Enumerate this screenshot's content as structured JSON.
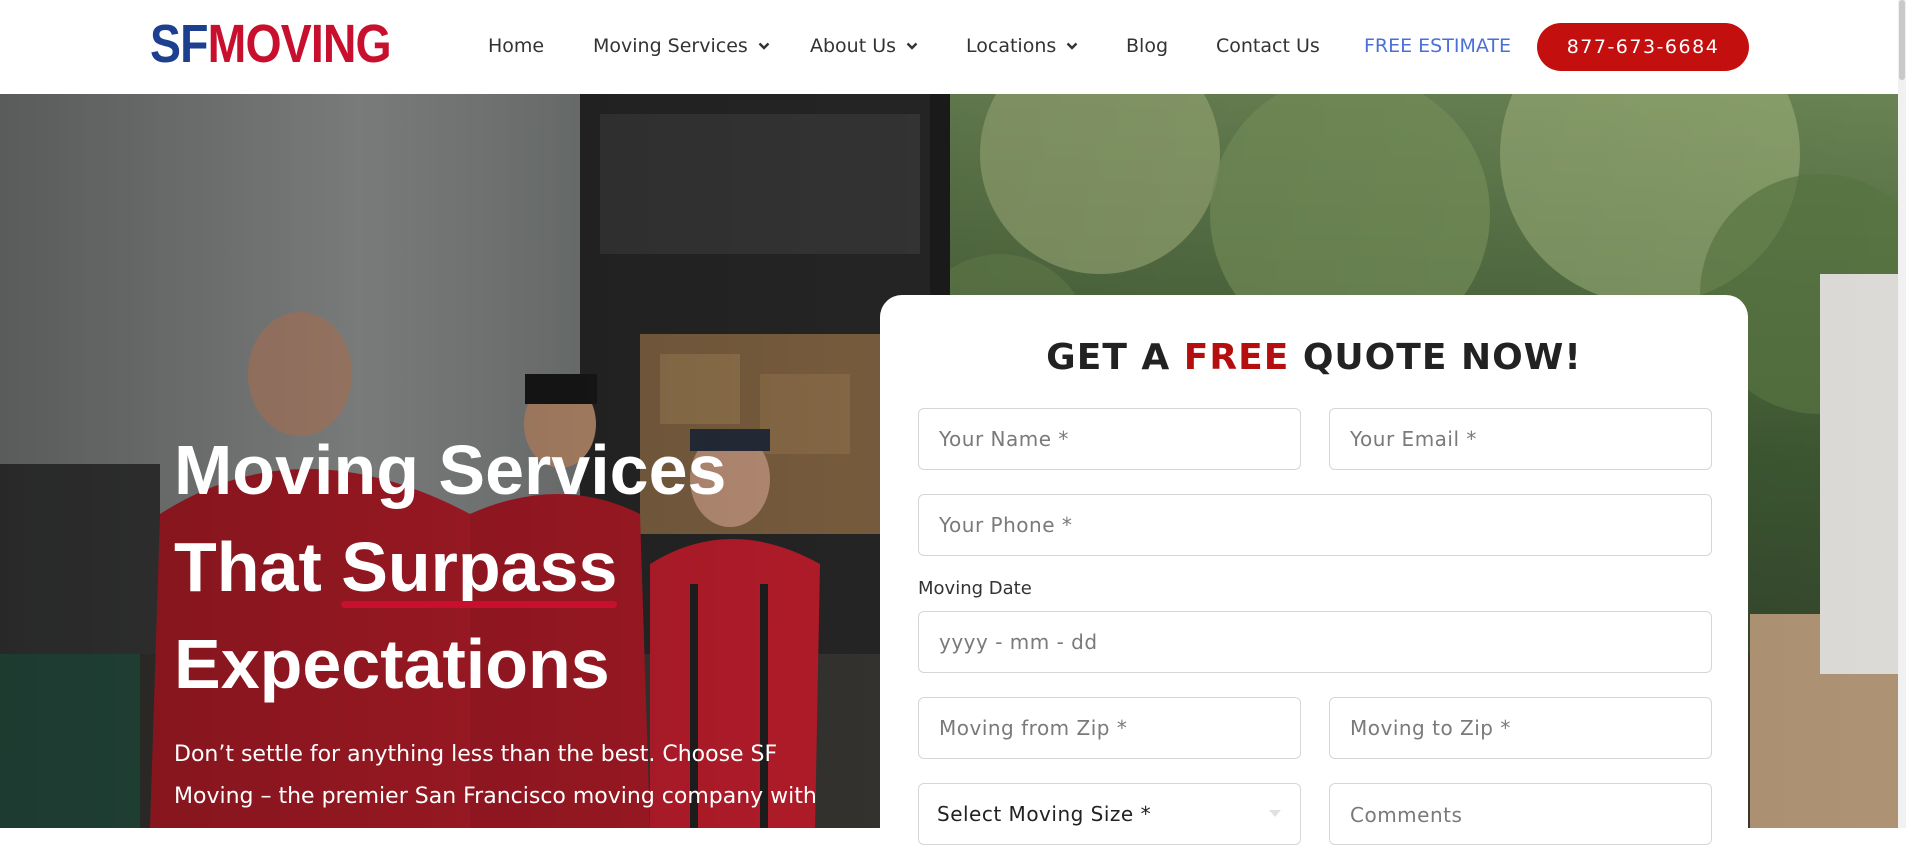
{
  "header": {
    "logo": {
      "part1": "SF",
      "part2": "MOVING"
    },
    "nav": [
      {
        "label": "Home",
        "dropdown": false
      },
      {
        "label": "Moving Services",
        "dropdown": true
      },
      {
        "label": "About Us",
        "dropdown": true
      },
      {
        "label": "Locations",
        "dropdown": true
      },
      {
        "label": "Blog",
        "dropdown": false
      },
      {
        "label": "Contact Us",
        "dropdown": false
      },
      {
        "label": "FREE ESTIMATE",
        "dropdown": false
      }
    ],
    "phone": "877-673-6684"
  },
  "hero": {
    "title_line1": "Moving Services",
    "title_line2a": "That ",
    "title_line2b": "Surpass",
    "title_line3": "Expectations",
    "description": "Don’t settle for anything less than the best. Choose SF Moving – the premier San Francisco moving company with"
  },
  "quote_form": {
    "title_pre": "GET A ",
    "title_highlight": "FREE",
    "title_post": " QUOTE NOW!",
    "name_placeholder": "Your Name *",
    "email_placeholder": "Your Email *",
    "phone_placeholder": "Your Phone *",
    "date_label": "Moving Date",
    "date_placeholder": "yyyy - mm - dd",
    "from_zip_placeholder": "Moving from Zip *",
    "to_zip_placeholder": "Moving to Zip *",
    "size_select": "Select Moving Size *",
    "comments_placeholder": "Comments"
  },
  "colors": {
    "brand_blue": "#1d3f8f",
    "brand_red": "#c8102e",
    "phone_button": "#c40f0f",
    "estimate_link": "#4a6fd8"
  },
  "icons": {
    "dropdown": "chevron-down-icon",
    "select": "select-caret-icon"
  }
}
